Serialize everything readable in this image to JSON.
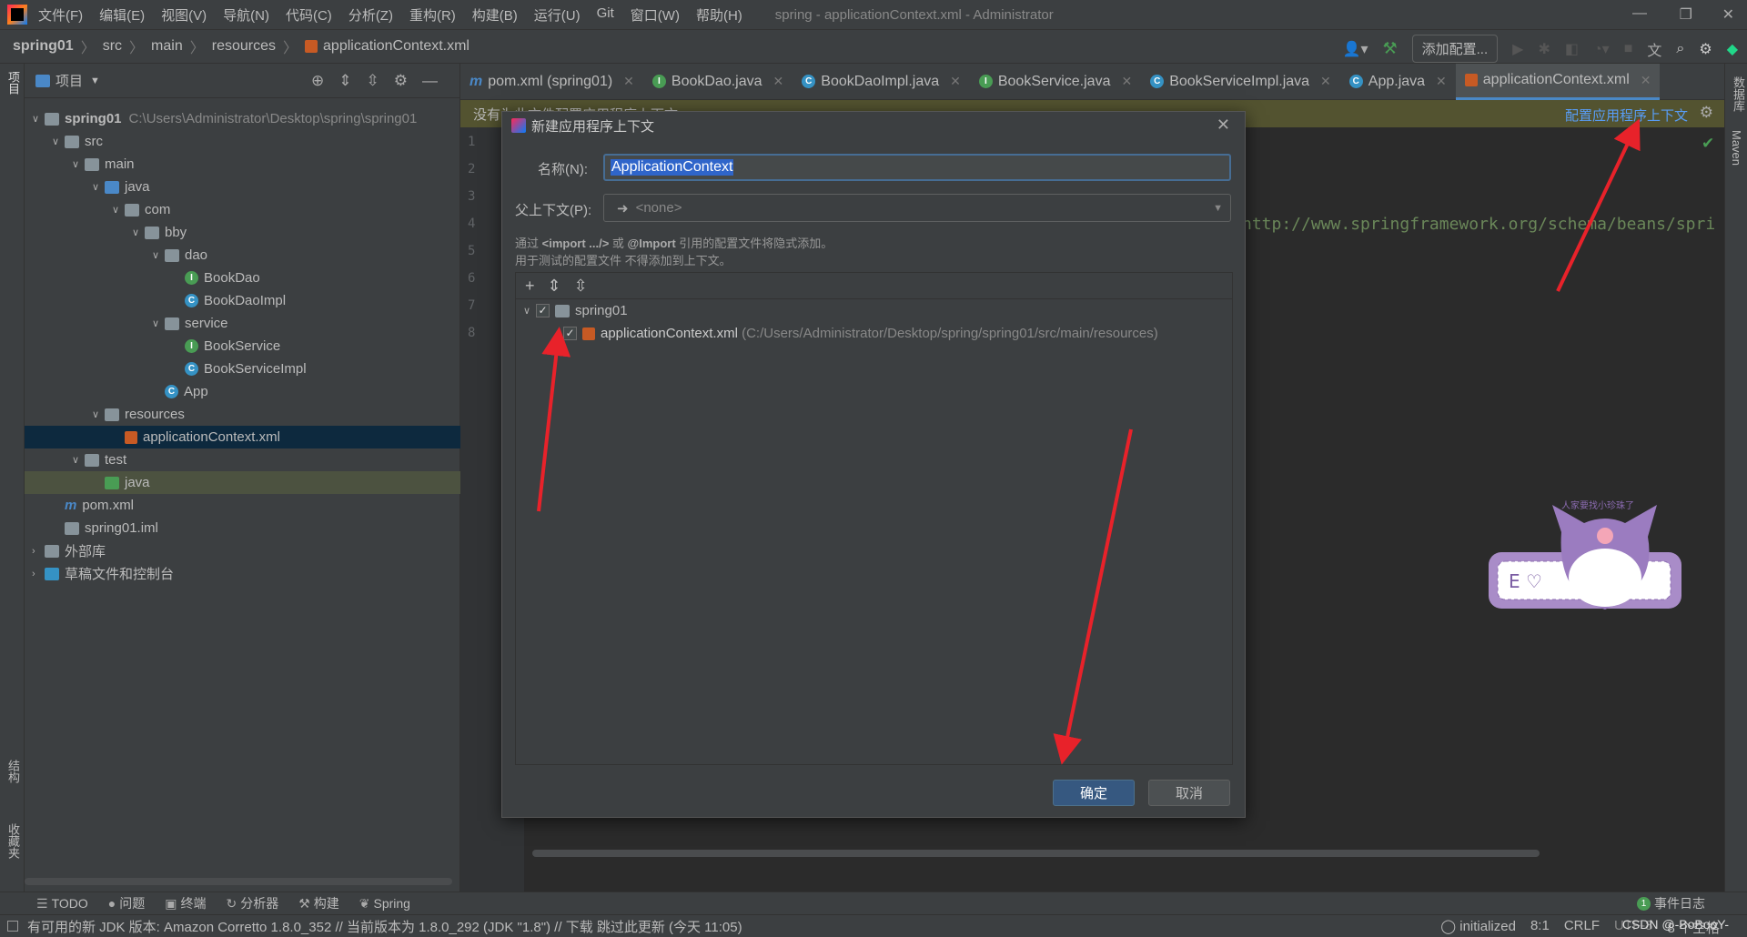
{
  "menubar": {
    "items": [
      "文件(F)",
      "编辑(E)",
      "视图(V)",
      "导航(N)",
      "代码(C)",
      "分析(Z)",
      "重构(R)",
      "构建(B)",
      "运行(U)",
      "Git",
      "窗口(W)",
      "帮助(H)"
    ],
    "window_title": "spring - applicationContext.xml - Administrator"
  },
  "breadcrumb": [
    "spring01",
    "src",
    "main",
    "resources",
    "applicationContext.xml"
  ],
  "toolbar": {
    "add_config": "添加配置..."
  },
  "project": {
    "header": "项目",
    "root_path": "C:\\Users\\Administrator\\Desktop\\spring\\spring01",
    "tree": [
      {
        "label": "spring01",
        "depth": 0,
        "type": "module",
        "open": true
      },
      {
        "label": "src",
        "depth": 1,
        "type": "folder",
        "open": true
      },
      {
        "label": "main",
        "depth": 2,
        "type": "folder",
        "open": true
      },
      {
        "label": "java",
        "depth": 3,
        "type": "src",
        "open": true
      },
      {
        "label": "com",
        "depth": 4,
        "type": "package",
        "open": true
      },
      {
        "label": "bby",
        "depth": 5,
        "type": "package",
        "open": true
      },
      {
        "label": "dao",
        "depth": 6,
        "type": "package",
        "open": true
      },
      {
        "label": "BookDao",
        "depth": 7,
        "type": "interface"
      },
      {
        "label": "BookDaoImpl",
        "depth": 7,
        "type": "class"
      },
      {
        "label": "service",
        "depth": 6,
        "type": "package",
        "open": true
      },
      {
        "label": "BookService",
        "depth": 7,
        "type": "interface"
      },
      {
        "label": "BookServiceImpl",
        "depth": 7,
        "type": "class"
      },
      {
        "label": "App",
        "depth": 6,
        "type": "class"
      },
      {
        "label": "resources",
        "depth": 3,
        "type": "res",
        "open": true
      },
      {
        "label": "applicationContext.xml",
        "depth": 4,
        "type": "xml",
        "selected": true
      },
      {
        "label": "test",
        "depth": 2,
        "type": "folder",
        "open": true
      },
      {
        "label": "java",
        "depth": 3,
        "type": "testsrc",
        "highlight": true
      },
      {
        "label": "pom.xml",
        "depth": 1,
        "type": "maven"
      },
      {
        "label": "spring01.iml",
        "depth": 1,
        "type": "iml"
      },
      {
        "label": "外部库",
        "depth": 0,
        "type": "lib",
        "open": false
      },
      {
        "label": "草稿文件和控制台",
        "depth": 0,
        "type": "scratch",
        "open": false
      }
    ]
  },
  "tabs": [
    {
      "label": "pom.xml (spring01)",
      "icon": "maven"
    },
    {
      "label": "BookDao.java",
      "icon": "interface"
    },
    {
      "label": "BookDaoImpl.java",
      "icon": "class"
    },
    {
      "label": "BookService.java",
      "icon": "interface"
    },
    {
      "label": "BookServiceImpl.java",
      "icon": "class"
    },
    {
      "label": "App.java",
      "icon": "class"
    },
    {
      "label": "applicationContext.xml",
      "icon": "xml",
      "active": true
    }
  ],
  "banner": {
    "text": "没有为此文件配置应用程序上下文",
    "link": "配置应用程序上下文"
  },
  "editor": {
    "line_numbers": [
      "1",
      "2",
      "3",
      "4",
      "5",
      "6",
      "7",
      "8"
    ],
    "visible_code": "http://www.springframework.org/schema/beans/spri"
  },
  "dialog": {
    "title": "新建应用程序上下文",
    "name_label": "名称(N):",
    "name_value": "ApplicationContext",
    "parent_label": "父上下文(P):",
    "parent_value": "<none>",
    "hint1_pre": "通过 ",
    "hint1_b1": "<import .../>",
    "hint1_mid": " 或 ",
    "hint1_b2": "@Import",
    "hint1_post": " 引用的配置文件将隐式添加。",
    "hint2": "用于测试的配置文件 不得添加到上下文。",
    "tree": {
      "module": "spring01",
      "file": "applicationContext.xml",
      "file_path": "(C:/Users/Administrator/Desktop/spring/spring01/src/main/resources)",
      "module_checked": true,
      "file_checked": true
    },
    "ok": "确定",
    "cancel": "取消"
  },
  "toolwindows": [
    "TODO",
    "问题",
    "终端",
    "分析器",
    "构建",
    "Spring"
  ],
  "event_log": "事件日志",
  "status": {
    "message": "有可用的新 JDK 版本: Amazon Corretto 1.8.0_352 // 当前版本为 1.8.0_292 (JDK \"1.8\") // 下载  跳过此更新 (今天 11:05)",
    "initialized": "initialized",
    "position": "8:1",
    "line_sep": "CRLF",
    "encoding": "UTF-8",
    "indent": "8 个空格",
    "watermark": "CSDN @-BoBooY-"
  },
  "side_labels": {
    "left_top": "项目",
    "left_mid": "结构",
    "left_bot": "收藏夹",
    "right_top": "数据库",
    "right_mid": "Maven"
  },
  "sticker_text": "人家要找小珍珠了",
  "colors": {
    "accent": "#4a88c7",
    "selection": "#2f65ca",
    "banner": "#535330",
    "arrow": "#e8222a",
    "link": "#589df6"
  }
}
